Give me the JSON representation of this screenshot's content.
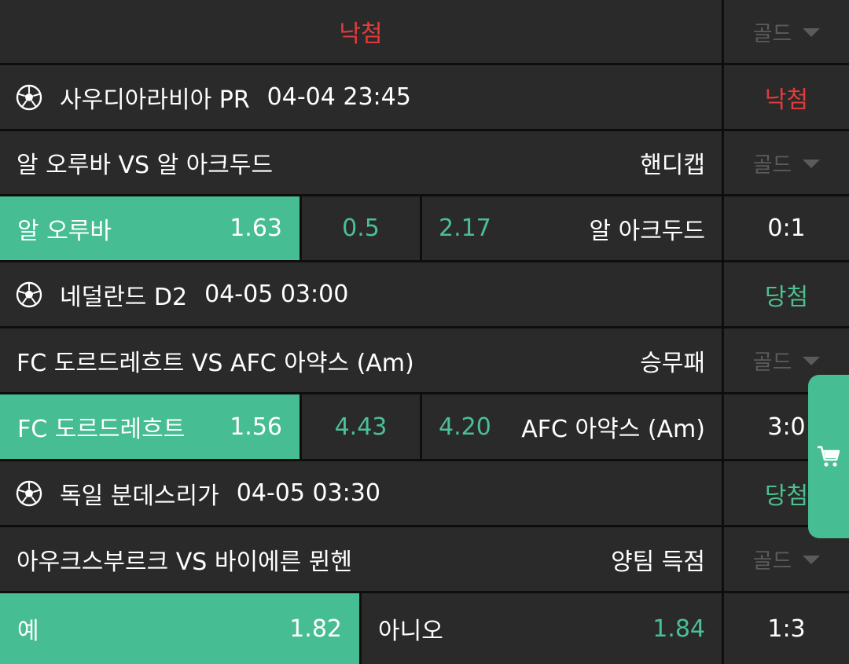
{
  "header": {
    "status": "낙첨",
    "dropdown": "골드"
  },
  "colors": {
    "accent": "#47bd93",
    "lost": "#e23b3b",
    "won": "#4cc08f",
    "background": "#2a2a2a"
  },
  "bets": [
    {
      "league": "사우디아라비아 PR",
      "datetime": "04-04 23:45",
      "result": "낙첨",
      "match": "알 오루바 VS 알 아크두드",
      "market": "핸디캡",
      "dropdown": "골드",
      "home": "알 오루바",
      "home_odds": "1.63",
      "mid": "0.5",
      "away_odds": "2.17",
      "away": "알 아크두드",
      "score": "0:1"
    },
    {
      "league": "네덜란드 D2",
      "datetime": "04-05 03:00",
      "result": "당첨",
      "match": "FC 도르드레흐트 VS AFC 아약스 (Am)",
      "market": "승무패",
      "dropdown": "골드",
      "home": "FC 도르드레흐트",
      "home_odds": "1.56",
      "mid": "4.43",
      "away_odds": "4.20",
      "away": "AFC 아약스 (Am)",
      "score": "3:0"
    },
    {
      "league": "독일 분데스리가",
      "datetime": "04-05 03:30",
      "result": "당첨",
      "match": "아우크스부르크 VS 바이에른 뮌헨",
      "market": "양팀 득점",
      "dropdown": "골드",
      "yes": "예",
      "yes_odds": "1.82",
      "no": "아니오",
      "no_odds": "1.84",
      "score": "1:3"
    }
  ],
  "icons": {
    "sport": "soccer-ball-icon",
    "cart": "cart-icon",
    "dropdown": "chevron-down-icon"
  }
}
